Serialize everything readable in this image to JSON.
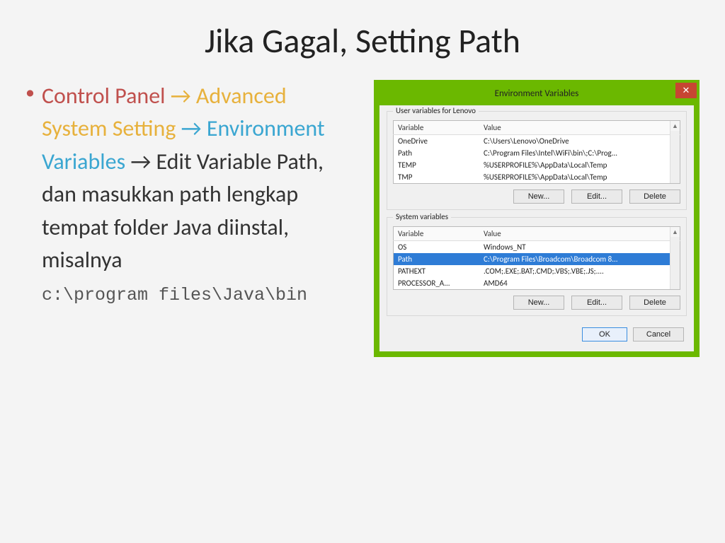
{
  "slide": {
    "title": "Jika Gagal, Setting Path",
    "bullet": {
      "seg_control_panel": "Control Panel",
      "arrow": " → ",
      "seg_advanced": "Advanced System Setting",
      "seg_envvar": "Environment Variables",
      "seg_rest": " → Edit Variable Path, dan masukkan path lengkap tempat folder Java diinstal, misalnya",
      "example_path": "c:\\program files\\Java\\bin"
    }
  },
  "dialog": {
    "title": "Environment Variables",
    "close_glyph": "✕",
    "user_group": {
      "legend": "User variables for Lenovo",
      "head_variable": "Variable",
      "head_value": "Value",
      "rows": [
        {
          "var": "OneDrive",
          "val": "C:\\Users\\Lenovo\\OneDrive"
        },
        {
          "var": "Path",
          "val": "C:\\Program Files\\Intel\\WiFi\\bin\\;C:\\Prog..."
        },
        {
          "var": "TEMP",
          "val": "%USERPROFILE%\\AppData\\Local\\Temp"
        },
        {
          "var": "TMP",
          "val": "%USERPROFILE%\\AppData\\Local\\Temp"
        }
      ],
      "btn_new": "New...",
      "btn_edit": "Edit...",
      "btn_delete": "Delete"
    },
    "system_group": {
      "legend": "System variables",
      "head_variable": "Variable",
      "head_value": "Value",
      "rows": [
        {
          "var": "OS",
          "val": "Windows_NT",
          "selected": false
        },
        {
          "var": "Path",
          "val": "C:\\Program Files\\Broadcom\\Broadcom 8...",
          "selected": true
        },
        {
          "var": "PATHEXT",
          "val": ".COM;.EXE;.BAT;.CMD;.VBS;.VBE;.JS;....",
          "selected": false
        },
        {
          "var": "PROCESSOR_A...",
          "val": "AMD64",
          "selected": false
        }
      ],
      "btn_new": "New...",
      "btn_edit": "Edit...",
      "btn_delete": "Delete"
    },
    "footer": {
      "ok": "OK",
      "cancel": "Cancel"
    },
    "scroll_up": "▲",
    "scroll_down": "▼"
  }
}
